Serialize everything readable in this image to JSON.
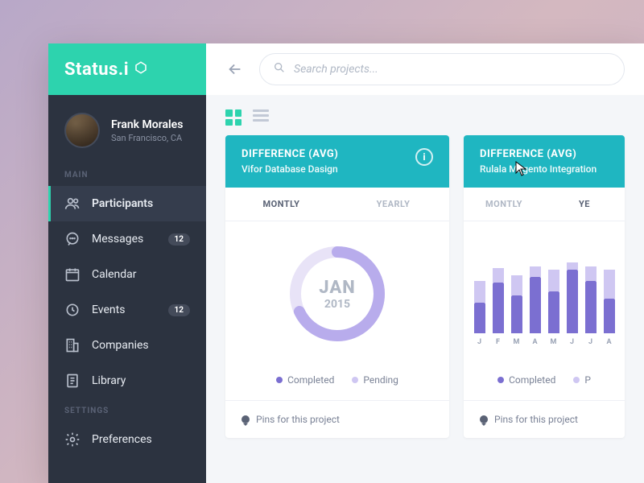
{
  "brand": "Status.i",
  "profile": {
    "name": "Frank Morales",
    "location": "San Francisco, CA"
  },
  "sections": {
    "main": "MAIN",
    "settings": "SETTINGS"
  },
  "nav": {
    "participants": "Participants",
    "messages": "Messages",
    "messages_badge": "12",
    "calendar": "Calendar",
    "events": "Events",
    "events_badge": "12",
    "companies": "Companies",
    "library": "Library",
    "preferences": "Preferences"
  },
  "search": {
    "placeholder": "Search projects..."
  },
  "card1": {
    "title": "DIFFERENCE (AVG)",
    "subtitle": "Vifor Database Dasign",
    "tab_monthly": "MONTLY",
    "tab_yearly": "YEARLY",
    "month": "JAN",
    "year": "2015",
    "legend_completed": "Completed",
    "legend_pending": "Pending",
    "pins": "Pins for this project"
  },
  "card2": {
    "title": "DIFFERENCE (AVG)",
    "subtitle": "Rulala Magento Integration",
    "tab_monthly": "MONTLY",
    "tab_yearly": "YE",
    "legend_completed": "Completed",
    "legend_pending": "P",
    "pins": "Pins for this project"
  },
  "chart_data": [
    {
      "type": "pie",
      "title": "Difference (Avg) — Vifor Database Dasign — Jan 2015",
      "series": [
        {
          "name": "Completed",
          "value": 68
        },
        {
          "name": "Pending",
          "value": 32
        }
      ]
    },
    {
      "type": "bar",
      "title": "Difference (Avg) — Rulala Magento Integration — Yearly",
      "categories": [
        "J",
        "F",
        "M",
        "A",
        "M",
        "J",
        "J",
        "A"
      ],
      "series": [
        {
          "name": "Completed",
          "values": [
            42,
            70,
            52,
            78,
            58,
            88,
            72,
            48
          ]
        },
        {
          "name": "Pending",
          "values": [
            30,
            20,
            28,
            14,
            30,
            10,
            20,
            40
          ]
        }
      ],
      "ylim": [
        0,
        100
      ]
    }
  ],
  "colors": {
    "completed": "#7b6fd1",
    "pending": "#cfc7f2",
    "accent": "#2dd3ae",
    "header": "#1fb6c1"
  }
}
